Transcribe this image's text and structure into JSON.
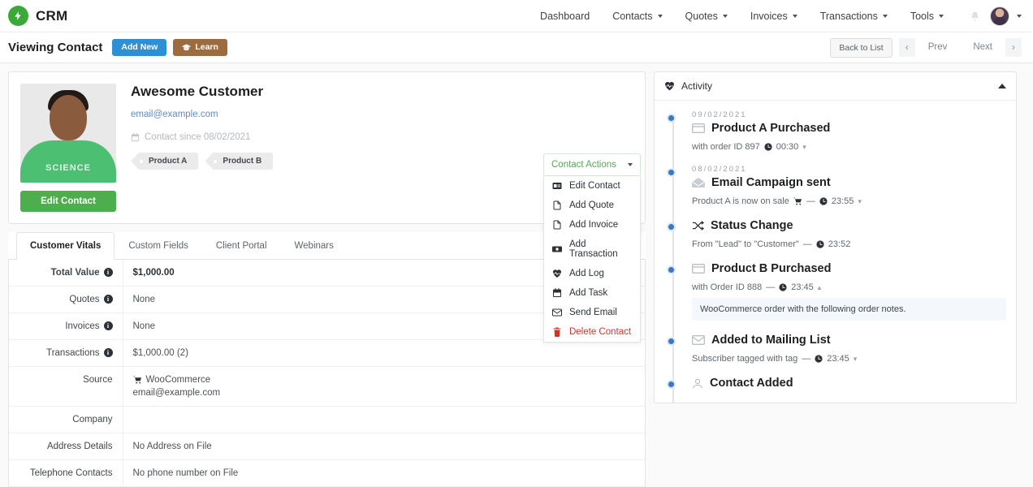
{
  "brand": {
    "name": "CRM",
    "logo_icon": "lightning-bolt-icon",
    "accent_green": "#3aa93a"
  },
  "nav": {
    "items": [
      {
        "label": "Dashboard",
        "has_caret": false
      },
      {
        "label": "Contacts",
        "has_caret": true
      },
      {
        "label": "Quotes",
        "has_caret": true
      },
      {
        "label": "Invoices",
        "has_caret": true
      },
      {
        "label": "Transactions",
        "has_caret": true
      },
      {
        "label": "Tools",
        "has_caret": true
      }
    ],
    "bell_icon": "bell-icon",
    "avatar_icon": "user-avatar",
    "avatar_caret": "chevron-down-icon"
  },
  "subheader": {
    "title": "Viewing Contact",
    "add_new_label": "Add New",
    "learn_label": "Learn",
    "learn_icon": "graduation-cap-icon",
    "back_to_list_label": "Back to List",
    "prev_label": "Prev",
    "next_label": "Next",
    "prev_chevron": "chevron-left-icon",
    "next_chevron": "chevron-right-icon"
  },
  "contact": {
    "name": "Awesome Customer",
    "email": "email@example.com",
    "since_text": "Contact since 08/02/2021",
    "since_icon": "calendar-icon",
    "edit_button_label": "Edit Contact",
    "photo_shirt_text": "SCIENCE",
    "tags": [
      "Product A",
      "Product B"
    ]
  },
  "contact_actions": {
    "toggle_label": "Contact Actions",
    "toggle_caret": "caret-down-icon",
    "items": [
      {
        "label": "Edit Contact",
        "icon": "id-card-icon",
        "danger": false
      },
      {
        "label": "Add Quote",
        "icon": "file-icon",
        "danger": false
      },
      {
        "label": "Add Invoice",
        "icon": "file-icon",
        "danger": false
      },
      {
        "label": "Add Transaction",
        "icon": "money-bill-icon",
        "danger": false
      },
      {
        "label": "Add Log",
        "icon": "heartbeat-icon",
        "danger": false
      },
      {
        "label": "Add Task",
        "icon": "calendar-icon",
        "danger": false
      },
      {
        "label": "Send Email",
        "icon": "envelope-icon",
        "danger": false
      },
      {
        "label": "Delete Contact",
        "icon": "trash-icon",
        "danger": true
      }
    ]
  },
  "tabs": [
    {
      "label": "Customer Vitals",
      "active": true
    },
    {
      "label": "Custom Fields",
      "active": false
    },
    {
      "label": "Client Portal",
      "active": false
    },
    {
      "label": "Webinars",
      "active": false
    }
  ],
  "vitals": {
    "rows": [
      {
        "label": "Total Value",
        "info": true,
        "bold": true,
        "value": "$1,000.00",
        "value_bold": true
      },
      {
        "label": "Quotes",
        "info": true,
        "bold": false,
        "value": "None",
        "value_bold": false
      },
      {
        "label": "Invoices",
        "info": true,
        "bold": false,
        "value": "None",
        "value_bold": false
      },
      {
        "label": "Transactions",
        "info": true,
        "bold": false,
        "value": "$1,000.00 (2)",
        "value_bold": false
      },
      {
        "label": "Source",
        "info": false,
        "bold": false,
        "value": "WooCommerce",
        "value2": "email@example.com",
        "value_icon": "shopping-cart-icon",
        "value_bold": false
      },
      {
        "label": "Company",
        "info": false,
        "bold": false,
        "value": "",
        "value_bold": false
      },
      {
        "label": "Address Details",
        "info": false,
        "bold": false,
        "value": "No Address on File",
        "value_bold": false
      },
      {
        "label": "Telephone Contacts",
        "info": false,
        "bold": false,
        "value": "No phone number on File",
        "value_bold": false
      }
    ]
  },
  "activity": {
    "title": "Activity",
    "title_icon": "heartbeat-icon",
    "collapse_icon": "caret-up-icon",
    "items": [
      {
        "date": "09/02/2021",
        "title": "Product A Purchased",
        "icon": "credit-card-icon",
        "meta_text": "with order ID 897",
        "time": "00:30",
        "time_icon": "clock-icon",
        "chevron": "chevron-down-icon",
        "note": ""
      },
      {
        "date": "08/02/2021",
        "title": "Email Campaign sent",
        "icon": "envelope-open-icon",
        "meta_text": "Product A is now on sale",
        "meta_icon": "shopping-cart-icon",
        "dash": "—",
        "time": "23:55",
        "time_icon": "clock-icon",
        "chevron": "chevron-down-icon",
        "note": ""
      },
      {
        "date": "",
        "title": "Status Change",
        "icon": "shuffle-icon",
        "meta_text": "From \"Lead\" to \"Customer\"",
        "dash": "—",
        "time": "23:52",
        "time_icon": "clock-icon",
        "chevron": "",
        "note": ""
      },
      {
        "date": "",
        "title": "Product B Purchased",
        "icon": "credit-card-icon",
        "meta_text": "with Order ID 888",
        "dash": "—",
        "time": "23:45",
        "time_icon": "clock-icon",
        "chevron": "chevron-up-icon",
        "note": "WooCommerce order with the following order notes."
      },
      {
        "date": "",
        "title": "Added to Mailing List",
        "icon": "envelope-icon",
        "meta_text": "Subscriber tagged with tag",
        "dash": "—",
        "time": "23:45",
        "time_icon": "clock-icon",
        "chevron": "chevron-down-icon",
        "note": ""
      },
      {
        "date": "",
        "title": "Contact Added",
        "icon": "user-icon",
        "meta_text": "",
        "time": "",
        "chevron": "",
        "note": ""
      }
    ]
  }
}
